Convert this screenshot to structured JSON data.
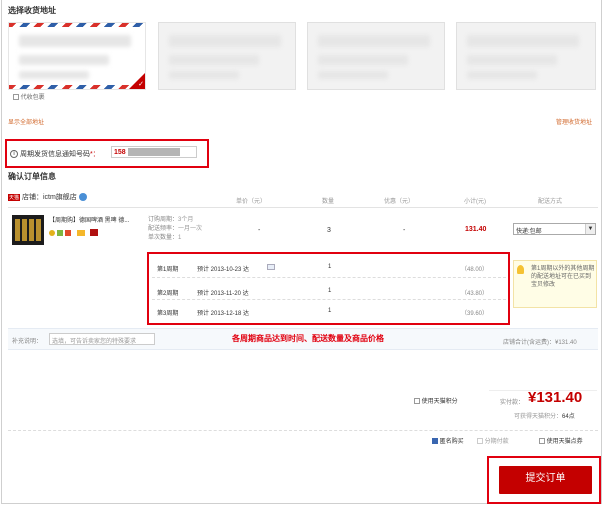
{
  "address_section": {
    "title": "选择收货地址",
    "proxy_checkbox_label": "代收包裹",
    "show_all_link": "显示全部地址",
    "manage_link": "管理收货地址"
  },
  "notify_phone": {
    "label": "周期发货信息通知号码",
    "required_mark": "*：",
    "value_prefix": "158"
  },
  "order_section": {
    "title": "确认订单信息",
    "store_prefix": "店铺：",
    "store_name": "ictm旗舰店",
    "tmall_badge": "天猫"
  },
  "table_headers": [
    "单价（元）",
    "数量",
    "优惠（元）",
    "小计(元)",
    "配送方式"
  ],
  "product": {
    "name": "【周期购】德国啤酒 黑啤 德...",
    "period_label": "订购周期：",
    "period_value": "3个月",
    "freq_label": "配送频率：",
    "freq_value": "一月一次",
    "qty_label": "单次数量：",
    "qty_value": "1",
    "unit_price": "-",
    "quantity": "3",
    "discount": "-",
    "subtotal": "131.40",
    "shipping_option": "快递:包邮"
  },
  "cycles": [
    {
      "label": "第1周期",
      "eta": "预计 2013-10-23 达",
      "qty": "1",
      "price": "（48.00）"
    },
    {
      "label": "第2周期",
      "eta": "预计 2013-11-20 达",
      "qty": "1",
      "price": "（43.80）"
    },
    {
      "label": "第3周期",
      "eta": "预计 2013-12-18 达",
      "qty": "1",
      "price": "（39.60）"
    }
  ],
  "cycle_note": "第1周期以外的其他周期的配送地址可在已买到宝贝修改",
  "remark": {
    "label": "补充说明：",
    "placeholder": "选填，可告诉卖家您的特殊要求"
  },
  "annotation": "各周期商品达到时间、配送数量及商品价格",
  "store_total": "店铺合计(含运费)：¥131.40",
  "tmall_points_label": "使用天猫积分",
  "payment": {
    "label": "实付款：",
    "amount": "¥131.40",
    "points_text": "可获得天猫积分：",
    "points_value": "64点"
  },
  "options": {
    "anonymous": "匿名购买",
    "installment": "分期付款",
    "tmall_coupon": "使用天猫点券"
  },
  "submit_label": "提交订单",
  "colors": {
    "accent_red": "#c40000",
    "annotation_red": "#e1000f",
    "link_orange": "#d26a2e"
  }
}
